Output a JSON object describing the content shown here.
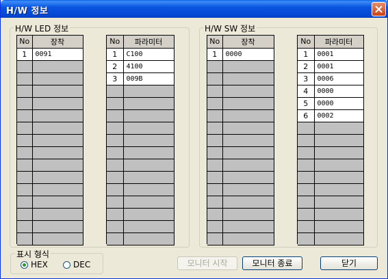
{
  "window": {
    "title": "H/W 정보"
  },
  "led_group": {
    "label": "H/W LED 정보",
    "left_table": {
      "headers": [
        "No",
        "장착"
      ],
      "rows": [
        [
          "1",
          "0091"
        ]
      ]
    },
    "right_table": {
      "headers": [
        "No",
        "파라미터"
      ],
      "rows": [
        [
          "1",
          "C100"
        ],
        [
          "2",
          "4100"
        ],
        [
          "3",
          "009B"
        ]
      ]
    }
  },
  "sw_group": {
    "label": "H/W SW 정보",
    "left_table": {
      "headers": [
        "No",
        "장착"
      ],
      "rows": [
        [
          "1",
          "0000"
        ]
      ]
    },
    "right_table": {
      "headers": [
        "No",
        "파라미터"
      ],
      "rows": [
        [
          "1",
          "0001"
        ],
        [
          "2",
          "0001"
        ],
        [
          "3",
          "0006"
        ],
        [
          "4",
          "0000"
        ],
        [
          "5",
          "0000"
        ],
        [
          "6",
          "0002"
        ]
      ]
    }
  },
  "display_format": {
    "label": "표시 형식",
    "options": [
      "HEX",
      "DEC"
    ],
    "selected": "HEX"
  },
  "buttons": {
    "monitor_start": "모니터 시작",
    "monitor_stop": "모니터 종료",
    "close": "닫기"
  },
  "colors": {
    "title_bar": "#0A55E0",
    "window_bg": "#ECE9D8",
    "grid_empty": "#C0C0C0"
  }
}
